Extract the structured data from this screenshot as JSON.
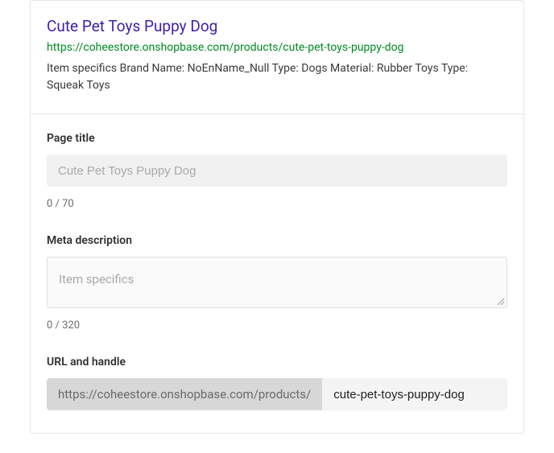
{
  "preview": {
    "title": "Cute Pet Toys Puppy Dog",
    "url": "https://coheestore.onshopbase.com/products/cute-pet-toys-puppy-dog",
    "description": "Item specifics Brand Name: NoEnName_Null Type: Dogs Material: Rubber Toys Type: Squeak Toys"
  },
  "fields": {
    "page_title": {
      "label": "Page title",
      "placeholder": "Cute Pet Toys Puppy Dog",
      "value": "",
      "counter": "0 / 70"
    },
    "meta_description": {
      "label": "Meta description",
      "placeholder": "Item specifics",
      "value": "",
      "counter": "0 / 320"
    },
    "url_handle": {
      "label": "URL and handle",
      "prefix": "https://coheestore.onshopbase.com/products/",
      "value": "cute-pet-toys-puppy-dog"
    }
  }
}
